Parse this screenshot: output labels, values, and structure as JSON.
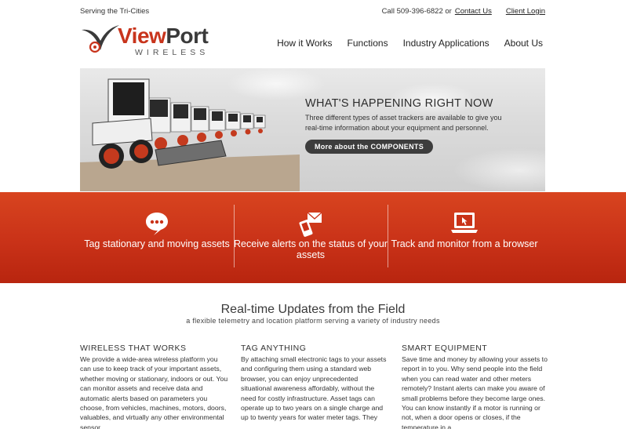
{
  "top": {
    "tagline": "Serving the Tri-Cities",
    "call": "Call 509-396-6822 or",
    "contact_link": "Contact Us",
    "client_login": "Client Login"
  },
  "logo": {
    "view": "View",
    "port": "Port",
    "sub": "WIRELESS"
  },
  "nav": {
    "items": [
      {
        "label": "How it Works"
      },
      {
        "label": "Functions"
      },
      {
        "label": "Industry Applications"
      },
      {
        "label": "About Us"
      }
    ]
  },
  "hero": {
    "title": "WHAT'S HAPPENING RIGHT NOW",
    "description": "Three different types of asset trackers are available to give you real-time information about your equipment and personnel.",
    "button": "More about the COMPONENTS"
  },
  "features": [
    {
      "label": "Tag stationary and moving assets",
      "icon": "chat-bubble-icon"
    },
    {
      "label": "Receive alerts on the status of your assets",
      "icon": "phone-mail-icon"
    },
    {
      "label": "Track and monitor from a browser",
      "icon": "laptop-icon"
    }
  ],
  "section": {
    "title": "Real-time Updates from the Field",
    "subtitle": "a flexible telemetry and location platform serving a variety of industry needs"
  },
  "columns": [
    {
      "heading": "WIRELESS THAT WORKS",
      "body": "We provide a wide-area wireless platform you can use to keep track of your important assets, whether moving or stationary, indoors or out. You can monitor assets and receive data and automatic alerts based on parameters you choose, from vehicles, machines, motors, doors, valuables, and virtually any other environmental sensor,"
    },
    {
      "heading": "TAG ANYTHING",
      "body": "By attaching small electronic tags to your assets and configuring them using a standard web browser, you can enjoy unprecedented situational awareness affordably, without the need for costly infrastructure. Asset tags can operate up to two years on a single charge and up to twenty years for water meter tags. They"
    },
    {
      "heading": "SMART EQUIPMENT",
      "body": "Save time and money by allowing your assets to report in to you. Why send people into the field when you can read water and other meters remotely? Instant alerts can make you aware of small problems before they become large ones. You can know instantly if a motor is running or not, when a door opens or closes, if the temperature in a"
    }
  ],
  "colors": {
    "brand_red": "#c8341c",
    "band_red": "#c93218",
    "button_dark": "#3d3d3d"
  }
}
